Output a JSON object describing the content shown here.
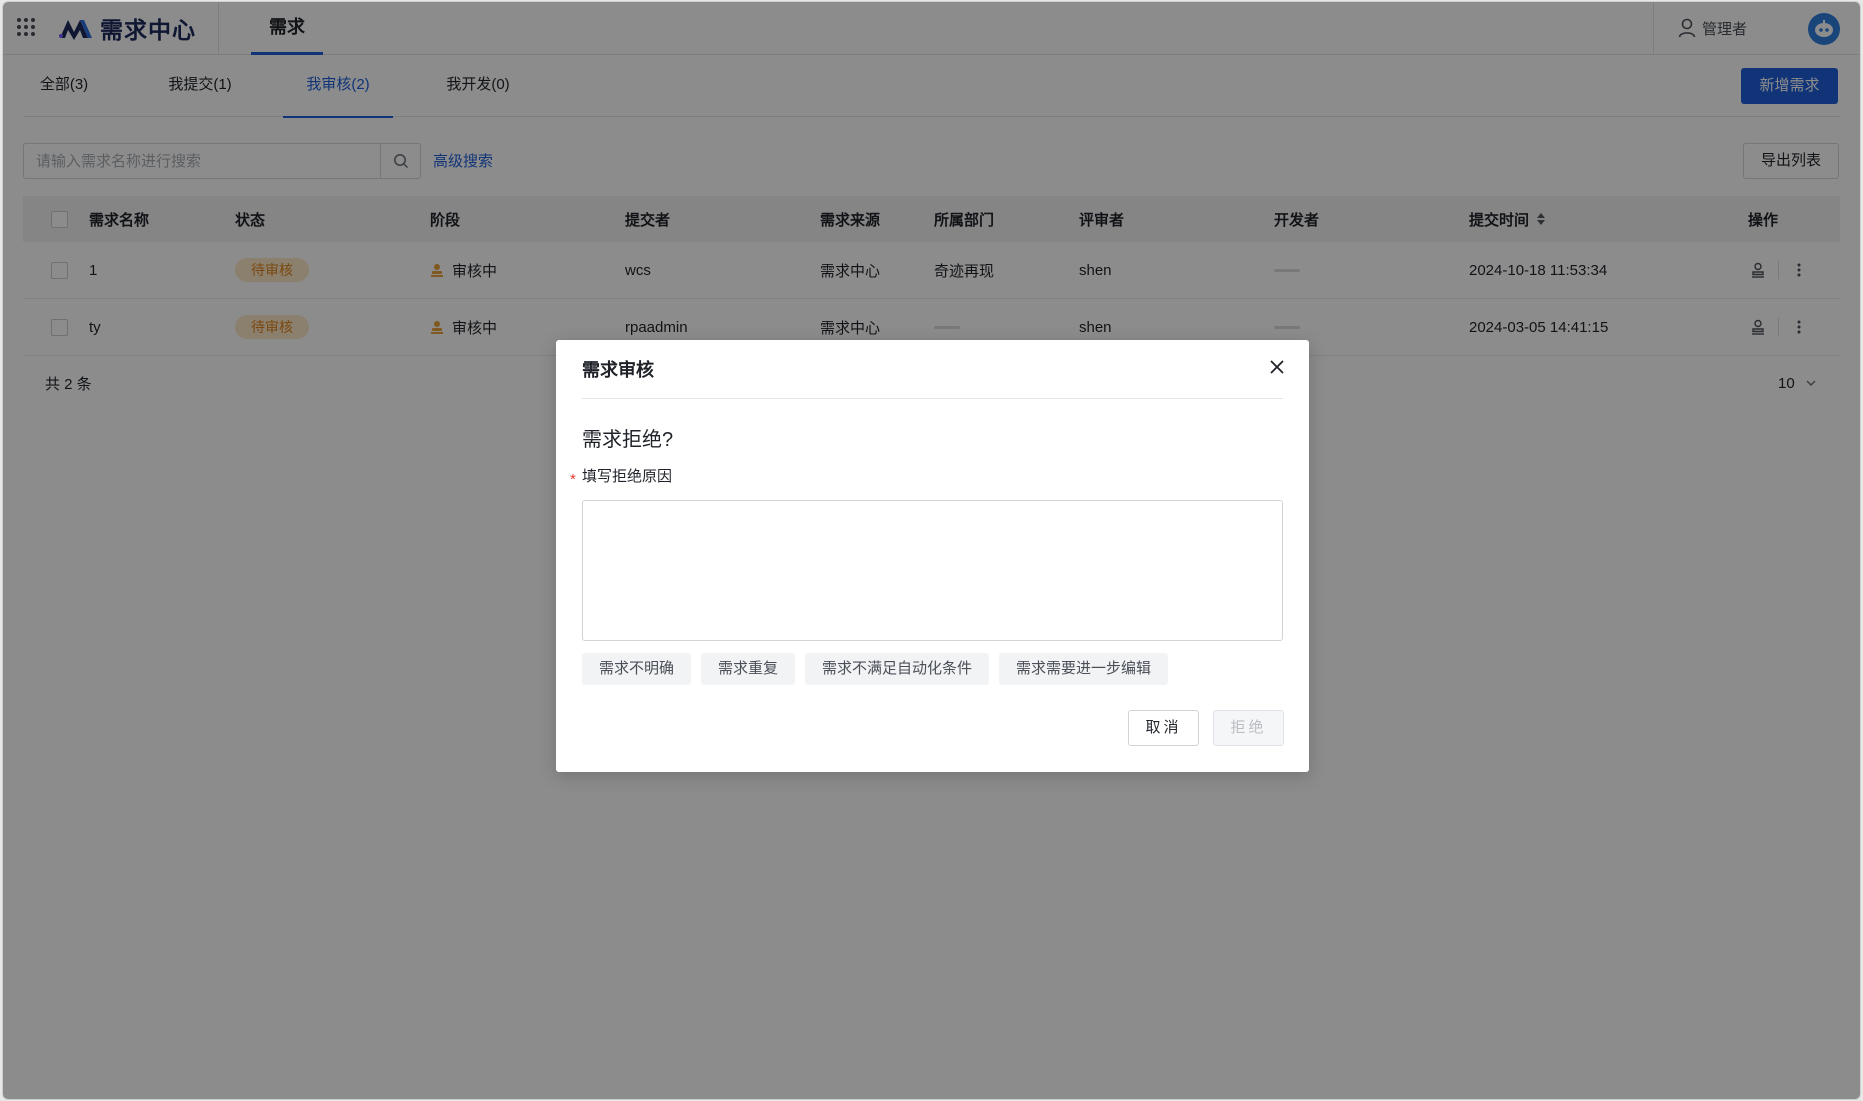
{
  "header": {
    "app_name": "需求中心",
    "nav_tab": "需求",
    "user_label": "管理者",
    "icons": {
      "apps": "apps-grid-icon",
      "logo": "logo-mark-icon",
      "user": "user-icon",
      "avatar": "robot-avatar-icon"
    }
  },
  "subtabs": [
    {
      "label": "全部(3)"
    },
    {
      "label": "我提交(1)"
    },
    {
      "label": "我审核(2)"
    },
    {
      "label": "我开发(0)"
    }
  ],
  "active_subtab": "我审核(2)",
  "toolbar": {
    "new_button": "新增需求",
    "search_placeholder": "请输入需求名称进行搜索",
    "advanced_search": "高级搜索",
    "export_button": "导出列表"
  },
  "table": {
    "columns": [
      "需求名称",
      "状态",
      "阶段",
      "提交者",
      "需求来源",
      "所属部门",
      "评审者",
      "开发者",
      "提交时间",
      "操作"
    ],
    "rows": [
      {
        "name": "1",
        "status": "待审核",
        "stage": "审核中",
        "submitter": "wcs",
        "source": "需求中心",
        "department": "奇迹再现",
        "reviewer": "shen",
        "developer": "",
        "time": "2024-10-18 11:53:34"
      },
      {
        "name": "ty",
        "status": "待审核",
        "stage": "审核中",
        "submitter": "rpaadmin",
        "source": "需求中心",
        "department": "",
        "reviewer": "shen",
        "developer": "",
        "time": "2024-03-05 14:41:15"
      }
    ],
    "total_text": "共 2 条",
    "page_size": "10"
  },
  "modal": {
    "title": "需求审核",
    "question": "需求拒绝?",
    "required_mark": "*",
    "field_label": "填写拒绝原因",
    "textarea_value": "",
    "quick_reasons": [
      "需求不明确",
      "需求重复",
      "需求不满足自动化条件",
      "需求需要进一步编辑"
    ],
    "cancel_button": "取消",
    "reject_button": "拒绝"
  },
  "colors": {
    "primary": "#1e5fd9",
    "badge_bg": "#fde7c9",
    "badge_text": "#e0861c",
    "required": "#e53935",
    "stage_icon": "#e8a33a"
  }
}
